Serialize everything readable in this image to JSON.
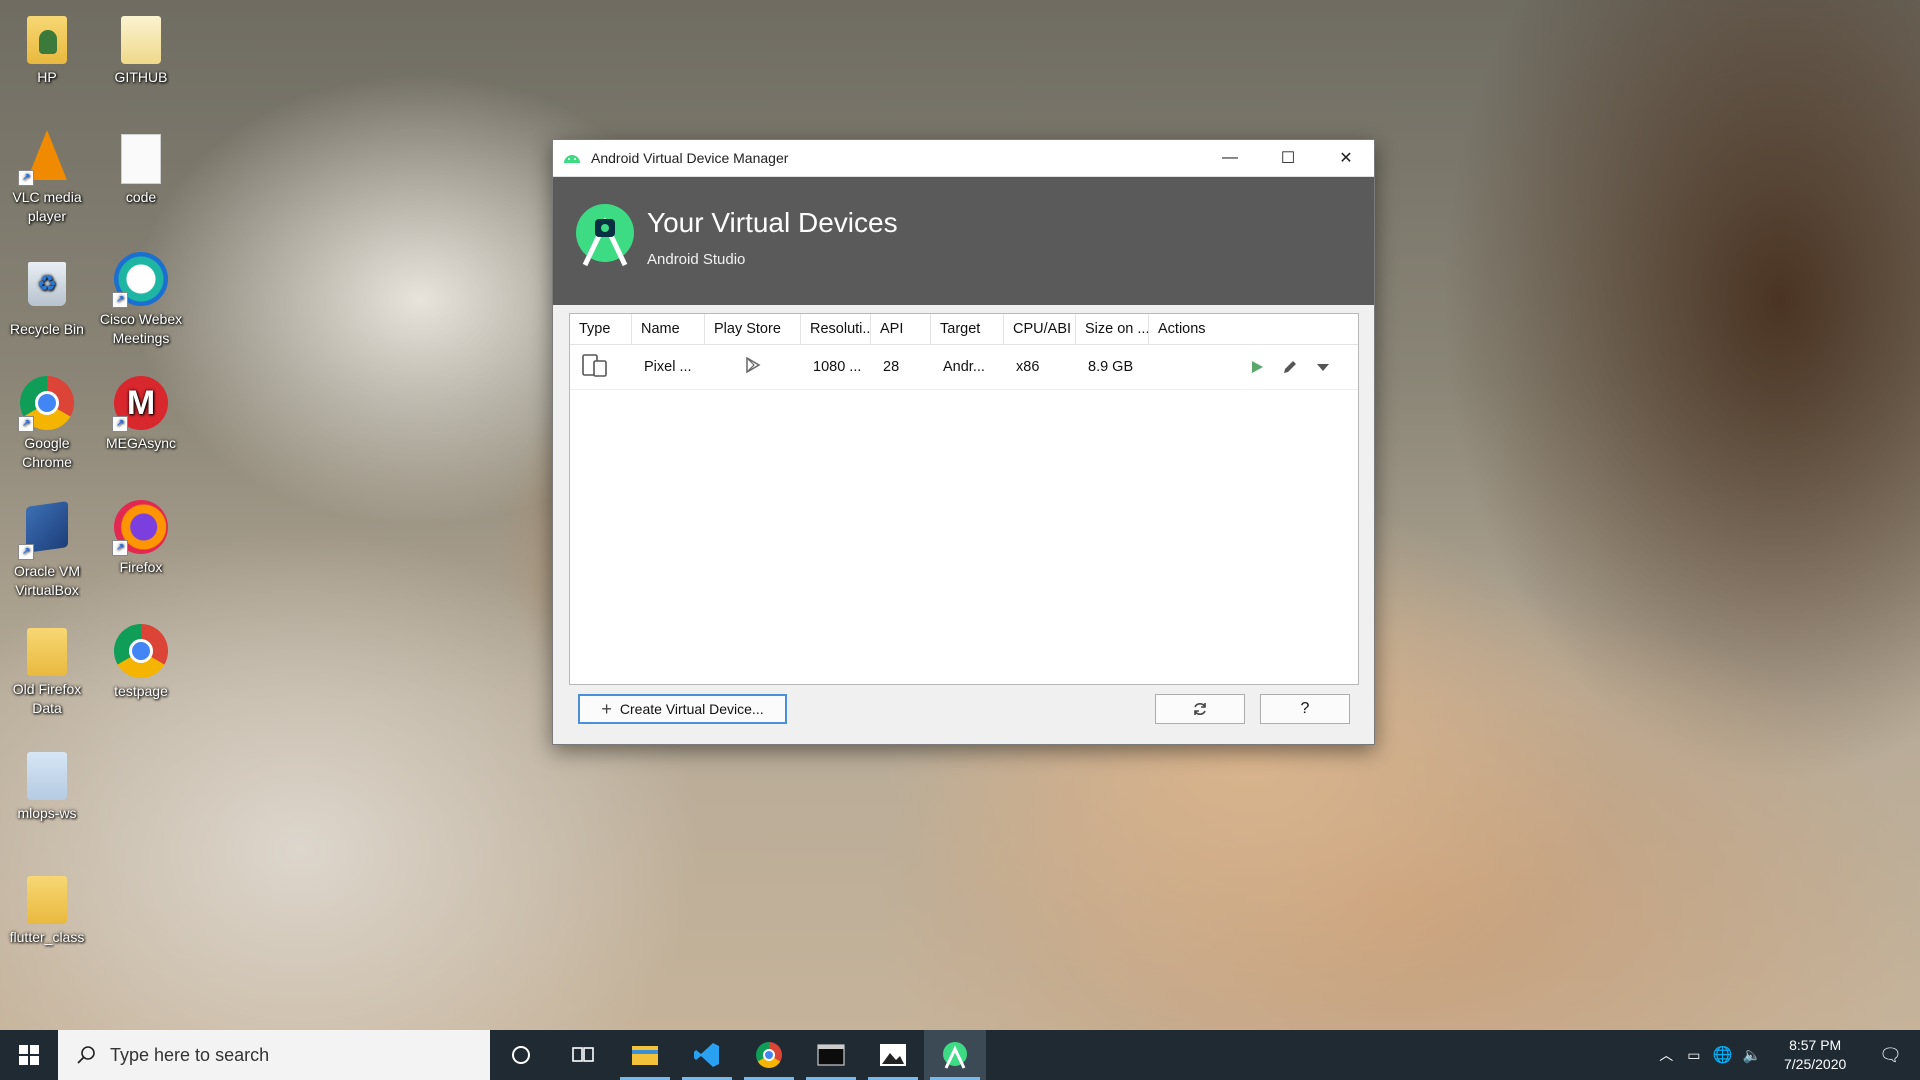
{
  "desktop": {
    "icons": [
      {
        "label": "HP"
      },
      {
        "label": "GITHUB"
      },
      {
        "label": "VLC media player"
      },
      {
        "label": "code"
      },
      {
        "label": "Recycle Bin"
      },
      {
        "label": "Cisco Webex Meetings"
      },
      {
        "label": "Google Chrome"
      },
      {
        "label": "MEGAsync"
      },
      {
        "label": "Oracle VM VirtualBox"
      },
      {
        "label": "Firefox"
      },
      {
        "label": "Old Firefox Data"
      },
      {
        "label": "testpage"
      },
      {
        "label": "mlops-ws"
      },
      {
        "label": "flutter_class"
      }
    ]
  },
  "window": {
    "title": "Android Virtual Device Manager",
    "controls": {
      "minimize": "—",
      "maximize": "☐",
      "close": "✕"
    },
    "header": {
      "title": "Your Virtual Devices",
      "subtitle": "Android Studio"
    },
    "table": {
      "columns": [
        "Type",
        "Name",
        "Play Store",
        "Resoluti...",
        "API",
        "Target",
        "CPU/ABI",
        "Size on ...",
        "Actions"
      ],
      "rows": [
        {
          "name": "Pixel ...",
          "resolution": "1080 ...",
          "api": "28",
          "target": "Andr...",
          "cpu": "x86",
          "size": "8.9 GB"
        }
      ]
    },
    "buttons": {
      "create": "Create Virtual Device...",
      "help": "?"
    },
    "colors": {
      "accent": "#4a90d9",
      "play": "#59a869",
      "header_bg": "#5a5a5a",
      "android_green": "#3ddc84"
    }
  },
  "taskbar": {
    "search_placeholder": "Type here to search",
    "clock": {
      "time": "8:57 PM",
      "date": "7/25/2020"
    }
  }
}
